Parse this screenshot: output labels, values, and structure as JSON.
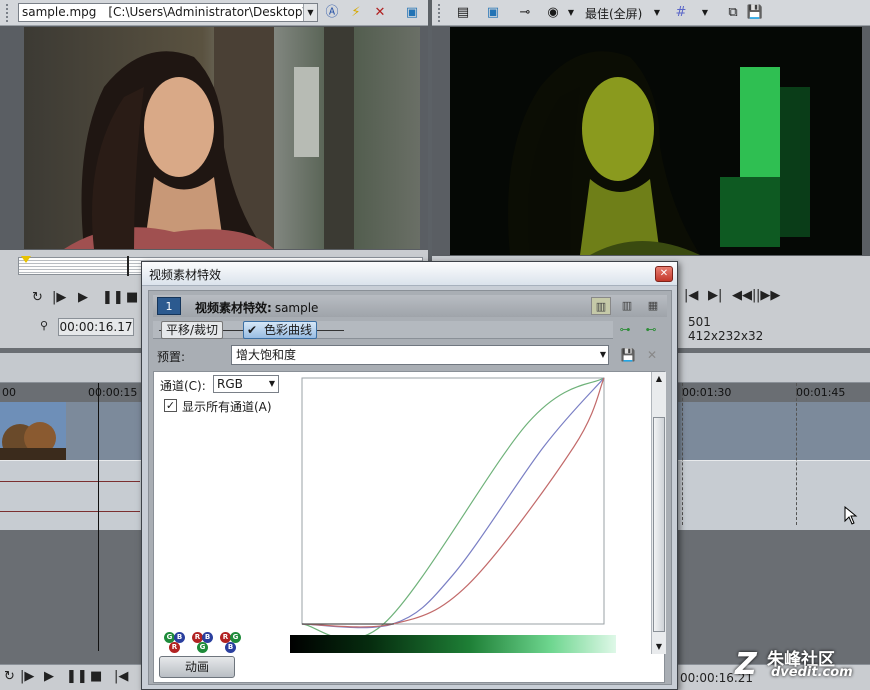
{
  "left_preview": {
    "file_name": "sample.mpg",
    "file_path": "[C:\\Users\\Administrator\\Desktop\\]",
    "timecode": "00:00:16.17"
  },
  "right_preview": {
    "quality": "最佳(全屏)",
    "frame": "501",
    "size": "412x232x32"
  },
  "timeline": {
    "ruler_labels": [
      "00",
      "00:00:15",
      "00:01:30",
      "00:01:45"
    ],
    "end_time": "00:00:16.21"
  },
  "dialog": {
    "title": "视频素材特效",
    "header_number": "1",
    "header_title_bold": "视频素材特效:",
    "header_title_name": "sample",
    "fx_chain": [
      "平移/裁切",
      "色彩曲线"
    ],
    "preset_label": "预置:",
    "preset_value": "增大饱和度",
    "channel_label": "通道(C):",
    "channel_value": "RGB",
    "show_all_label": "显示所有通道(A)",
    "show_all_checked": true,
    "animate_button": "动画",
    "channel_icons": [
      [
        "G",
        "B",
        "R"
      ],
      [
        "R",
        "B",
        "G"
      ],
      [
        "R",
        "G",
        "B"
      ]
    ],
    "curves": {
      "green": [
        [
          0,
          0
        ],
        [
          0.27,
          0
        ],
        [
          0.75,
          0.82
        ],
        [
          1,
          1
        ]
      ],
      "blue": [
        [
          0,
          0
        ],
        [
          0.3,
          0
        ],
        [
          0.5,
          0.2
        ],
        [
          0.8,
          0.72
        ],
        [
          1,
          1
        ]
      ],
      "red": [
        [
          0,
          0
        ],
        [
          0.3,
          0
        ],
        [
          0.55,
          0.16
        ],
        [
          0.9,
          0.72
        ],
        [
          1,
          1
        ]
      ]
    }
  },
  "watermark": {
    "cn": "朱峰社区",
    "en": "dvedit.com"
  }
}
